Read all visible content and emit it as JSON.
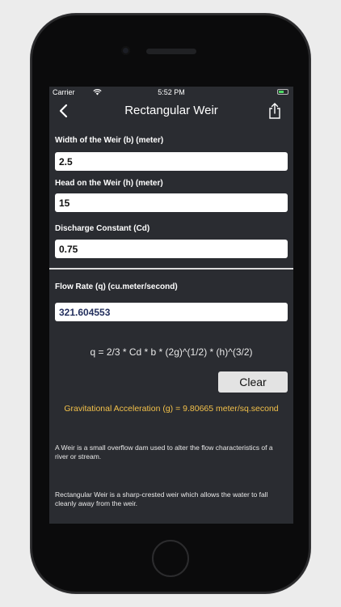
{
  "status": {
    "carrier": "Carrier",
    "time": "5:52 PM"
  },
  "nav": {
    "title": "Rectangular Weir"
  },
  "inputs": {
    "width": {
      "label": "Width of the Weir (b) (meter)",
      "value": "2.5"
    },
    "head": {
      "label": "Head on the Weir (h) (meter)",
      "value": "15"
    },
    "cd": {
      "label": "Discharge Constant (Cd)",
      "value": "0.75"
    }
  },
  "output": {
    "label": "Flow Rate (q) (cu.meter/second)",
    "value": "321.604553"
  },
  "formula": "q = 2/3 * Cd * b * (2g)^(1/2) * (h)^(3/2)",
  "clear_label": "Clear",
  "gravity": "Gravitational Acceleration (g) = 9.80665 meter/sq.second",
  "descriptions": [
    "A Weir is a small overflow dam used to alter the flow characteristics of a river or stream.",
    "Rectangular Weir is a sharp-crested weir which allows the water to fall cleanly away from the weir."
  ],
  "colors": {
    "background": "#2a2c31",
    "accent": "#f2c04a",
    "result_text": "#24305e"
  },
  "icons": [
    "wifi-icon",
    "battery-icon",
    "back-icon",
    "share-icon"
  ]
}
